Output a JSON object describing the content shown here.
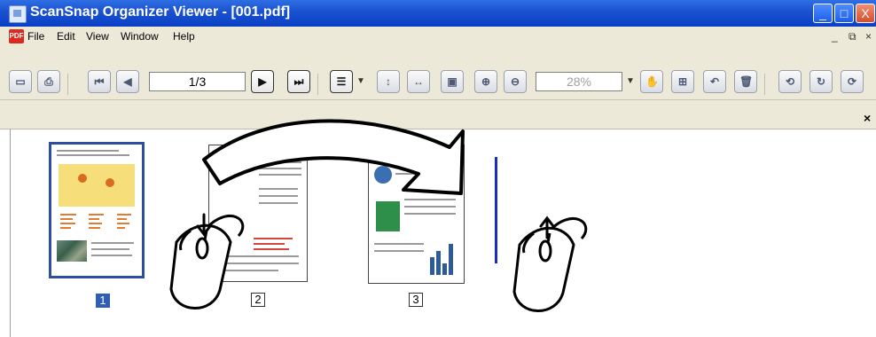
{
  "window": {
    "title": "ScanSnap Organizer Viewer - [001.pdf]",
    "controls": [
      "_",
      "□",
      "X"
    ]
  },
  "menubar": {
    "items": [
      "File",
      "Edit",
      "View",
      "Window",
      "Help"
    ],
    "mdi_controls": [
      "_",
      "⧉",
      "×"
    ]
  },
  "toolbar": {
    "page_input": "1/3",
    "zoom_input": "28%"
  },
  "panel": {
    "close_label": "×"
  },
  "thumbnails": [
    {
      "page": "1",
      "selected": true
    },
    {
      "page": "2",
      "selected": false
    },
    {
      "page": "3",
      "selected": false
    }
  ]
}
